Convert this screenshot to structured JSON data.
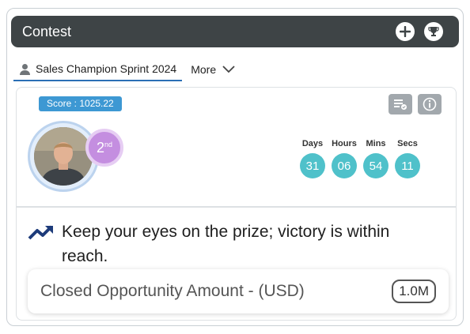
{
  "header": {
    "title": "Contest",
    "add_icon": "plus-circle-icon",
    "trophy_icon": "trophy-icon"
  },
  "tabs": {
    "active_label": "Sales Champion Sprint 2024",
    "more_label": "More"
  },
  "card": {
    "score_label": "Score : 1025.22",
    "rank_number": "2",
    "rank_suffix": "nd",
    "timer": [
      {
        "label": "Days",
        "value": "31"
      },
      {
        "label": "Hours",
        "value": "06"
      },
      {
        "label": "Mins",
        "value": "54"
      },
      {
        "label": "Secs",
        "value": "11"
      }
    ],
    "motto": "Keep your eyes on the prize; victory is within reach.",
    "metric_name": "Closed Opportunity Amount - (USD)",
    "metric_value": "1.0M"
  },
  "colors": {
    "header_bg": "#3e4446",
    "accent": "#2a6fb5",
    "score_badge": "#3d98d3",
    "timer": "#4fc1ca",
    "rank": "#c48ee0"
  }
}
